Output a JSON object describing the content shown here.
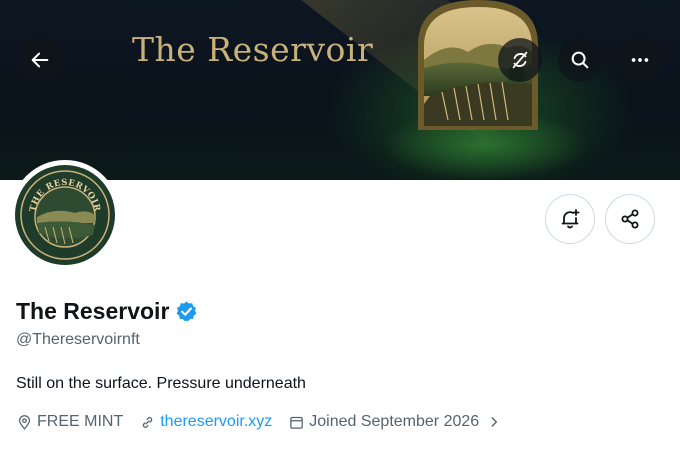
{
  "banner": {
    "title": "The Reservoir"
  },
  "header_buttons": {
    "back": "back-arrow-icon",
    "refresh": "refresh-icon",
    "search": "search-icon",
    "more": "more-icon"
  },
  "avatar": {
    "text": "THE RESERVOIR"
  },
  "profile": {
    "name": "The Reservoir",
    "handle": "@Thereservoirnft",
    "bio": "Still on the surface. Pressure underneath",
    "location": "FREE MINT",
    "website": "thereservoir.xyz",
    "joined": "Joined September 2026"
  },
  "colors": {
    "accent": "#1d9bf0",
    "banner_text": "#c9b27a",
    "avatar_bg": "#1f3b2a"
  }
}
